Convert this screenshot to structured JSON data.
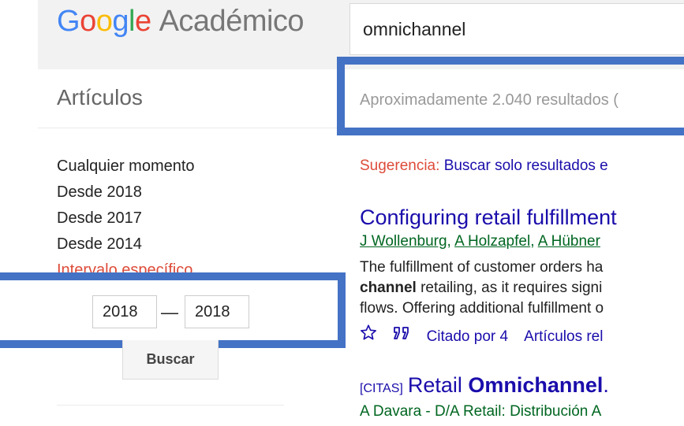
{
  "header": {
    "logo_google": "Google",
    "logo_product": "Académico",
    "search_value": "omnichannel"
  },
  "sidebar": {
    "section_title": "Artículos",
    "filters": [
      {
        "label": "Cualquier momento"
      },
      {
        "label": "Desde 2018"
      },
      {
        "label": "Desde 2017"
      },
      {
        "label": "Desde 2014"
      },
      {
        "label": "Intervalo específico..."
      }
    ],
    "date_from": "2018",
    "date_to": "2018",
    "dash": "—",
    "search_button": "Buscar"
  },
  "results": {
    "count_text": "Aproximadamente 2.040 resultados (",
    "suggestion_label": "Sugerencia:",
    "suggestion_link": "Buscar solo resultados e",
    "items": [
      {
        "title": "Configuring retail fulfillment",
        "authors": [
          "J Wollenburg",
          "A Holzapfel",
          "A Hübner"
        ],
        "snippet_line1": "The fulfillment of customer orders ha",
        "snippet_line2_bold": "channel",
        "snippet_line2_rest": " retailing, as it requires signi",
        "snippet_line3": "flows. Offering additional fulfillment o",
        "cited_by": "Citado por 4",
        "related": "Artículos rel"
      },
      {
        "tag": "[CITAS]",
        "title_prefix": "Retail ",
        "title_bold": "Omnichannel",
        "title_suffix": ". ",
        "authors_line": "A Davara - D/A Retail: Distribución A"
      }
    ]
  },
  "colors": {
    "highlight_box": "#4472c4",
    "link": "#1a0dab",
    "author_green": "#006621",
    "active_red": "#dd4b39"
  },
  "icons": [
    "star-icon",
    "quote-icon"
  ]
}
